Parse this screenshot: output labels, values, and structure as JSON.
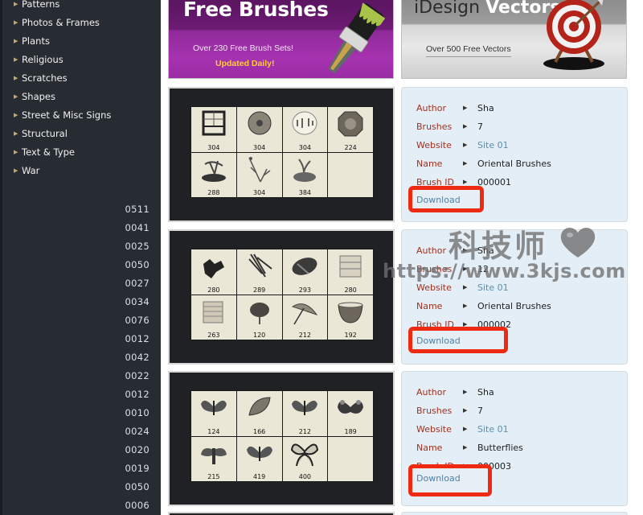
{
  "sidebar": {
    "categories": [
      "Patterns",
      "Photos & Frames",
      "Plants",
      "Religious",
      "Scratches",
      "Shapes",
      "Street & Misc Signs",
      "Structural",
      "Text & Type",
      "War"
    ],
    "counts": [
      "0511",
      "0041",
      "0025",
      "0050",
      "0027",
      "0034",
      "0076",
      "0012",
      "0042",
      "0022",
      "0012",
      "0010",
      "0024",
      "0020",
      "0019",
      "0050",
      "0006"
    ]
  },
  "banners": {
    "brushes": {
      "title": "Free Brushes",
      "subtitle": "Over 230 Free Brush Sets!",
      "tagline": "Updated Daily!"
    },
    "vectors": {
      "title_light": "iDesign",
      "title_bold": "Vectors",
      "subtitle": "Over 500 Free Vectors"
    }
  },
  "labels": {
    "author": "Author",
    "brushes": "Brushes",
    "website": "Website",
    "name": "Name",
    "brush_id": "Brush ID",
    "download": "Download"
  },
  "entries": [
    {
      "author": "Sha",
      "brushes": "7",
      "website": "Site 01",
      "name": "Oriental Brushes",
      "brush_id": "000001",
      "previews": [
        {
          "icon": "shoji-screen",
          "size": "304"
        },
        {
          "icon": "paper-umbrella",
          "size": "304"
        },
        {
          "icon": "paper-lantern",
          "size": "304"
        },
        {
          "icon": "bagua-mirror",
          "size": "224"
        },
        {
          "icon": "bonsai",
          "size": "288"
        },
        {
          "icon": "plum-branch",
          "size": "304"
        },
        {
          "icon": "bonsai-pot",
          "size": "384"
        }
      ]
    },
    {
      "author": "Sha",
      "brushes": "12",
      "website": "Site 01",
      "name": "Oriental Brushes",
      "brush_id": "000002",
      "previews": [
        {
          "icon": "tea-leaves",
          "size": "280"
        },
        {
          "icon": "chopsticks",
          "size": "289"
        },
        {
          "icon": "wrapped-bundle",
          "size": "293"
        },
        {
          "icon": "steamer-box",
          "size": "280"
        },
        {
          "icon": "steamer-stack",
          "size": "263"
        },
        {
          "icon": "red-lantern",
          "size": "120"
        },
        {
          "icon": "parasol",
          "size": "212"
        },
        {
          "icon": "porcelain-bowl",
          "size": "192"
        }
      ]
    },
    {
      "author": "Sha",
      "brushes": "7",
      "website": "Site 01",
      "name": "Butterflies",
      "brush_id": "000003",
      "previews": [
        {
          "icon": "butterfly",
          "size": "124"
        },
        {
          "icon": "leaf-butterfly",
          "size": "166"
        },
        {
          "icon": "butterfly",
          "size": "212"
        },
        {
          "icon": "peacock-butterfly",
          "size": "189"
        },
        {
          "icon": "moth",
          "size": "215"
        },
        {
          "icon": "butterfly",
          "size": "419"
        },
        {
          "icon": "swallowtail-butterfly",
          "size": "400"
        }
      ]
    }
  ],
  "watermark": {
    "text_cn": "科技师",
    "url": "https://www.3kjs.com"
  },
  "colors": {
    "sidebar_bg": "#272b32",
    "label_red": "#a2301f",
    "link_blue": "#5a8fb1",
    "info_bg": "#e3eef6",
    "highlight_red": "#ee2b12"
  }
}
